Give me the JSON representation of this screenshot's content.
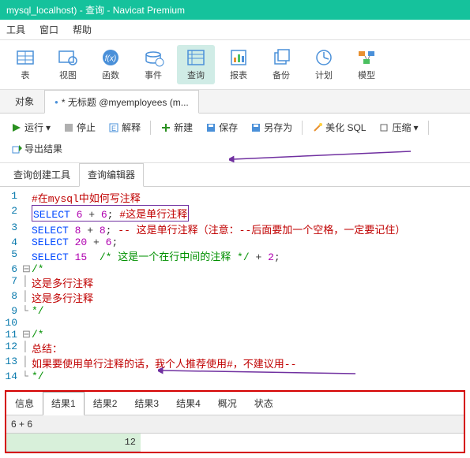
{
  "title": "mysql_localhost) - 查询 - Navicat Premium",
  "menus": {
    "tools": "工具",
    "window": "窗口",
    "help": "帮助"
  },
  "toolbar": {
    "table": "表",
    "view": "视图",
    "function": "函数",
    "event": "事件",
    "query": "查询",
    "report": "报表",
    "backup": "备份",
    "plan": "计划",
    "model": "模型"
  },
  "tabs": {
    "objects": "对象",
    "untitled": "* 无标题 @myemployees (m..."
  },
  "actions": {
    "run": "运行",
    "stop": "停止",
    "explain": "解释",
    "new": "新建",
    "save": "保存",
    "saveas": "另存为",
    "beautify": "美化 SQL",
    "minify": "压缩",
    "export": "导出结果"
  },
  "subtabs": {
    "builder": "查询创建工具",
    "editor": "查询编辑器"
  },
  "code": {
    "l1": "#在mysql中如何写注释",
    "l2a": "SELECT",
    "l2b": "6",
    "l2c": "6",
    "l2d": "#这是单行注释",
    "l3a": "SELECT",
    "l3b": "8",
    "l3c": "8",
    "l3d": "-- 这是单行注释（注意：--后面要加一个空格，一定要记住）",
    "l4a": "SELECT",
    "l4b": "20",
    "l4c": "6",
    "l5a": "SELECT",
    "l5b": "15",
    "l5c": "/* 这是一个在行中间的注释 */",
    "l5d": "2",
    "l6": "/*",
    "l7": "这是多行注释",
    "l8": "这是多行注释",
    "l9": "*/",
    "l11": "/*",
    "l12": "总结：",
    "l13": "如果要使用单行注释的话，我个人推荐使用#，不建议用--",
    "l14": "*/"
  },
  "result_tabs": {
    "info": "信息",
    "r1": "结果1",
    "r2": "结果2",
    "r3": "结果3",
    "r4": "结果4",
    "profile": "概况",
    "status": "状态"
  },
  "result": {
    "header": "6 + 6",
    "value": "12"
  }
}
